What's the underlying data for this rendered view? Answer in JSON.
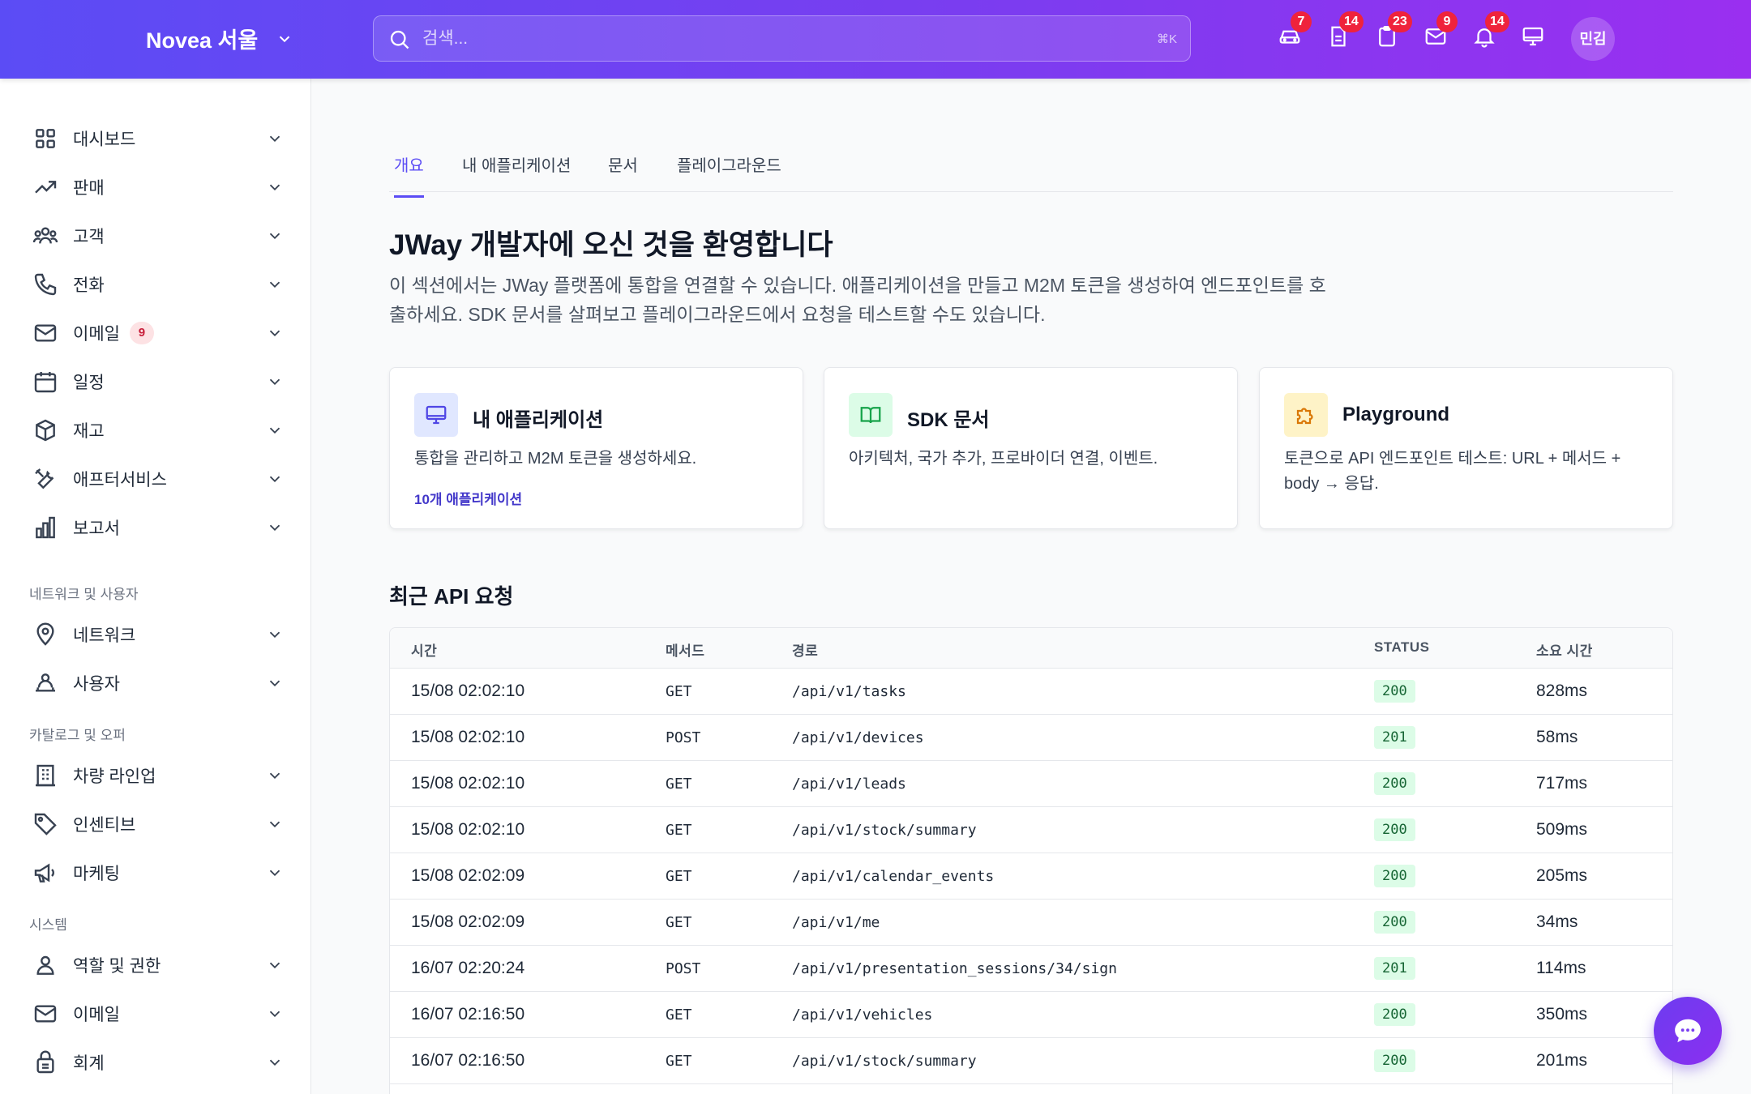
{
  "header": {
    "brand": "Novea 서울",
    "search_placeholder": "검색...",
    "search_shortcut": "⌘K",
    "icons": [
      {
        "name": "car-icon",
        "badge": "7"
      },
      {
        "name": "document-icon",
        "badge": "14"
      },
      {
        "name": "clipboard-icon",
        "badge": "23"
      },
      {
        "name": "mail-icon",
        "badge": "9"
      },
      {
        "name": "bell-icon",
        "badge": "14"
      },
      {
        "name": "monitor-icon",
        "badge": ""
      }
    ],
    "avatar_initials": "민김"
  },
  "sidebar": {
    "items": [
      {
        "label": "대시보드",
        "icon": "grid-icon"
      },
      {
        "label": "판매",
        "icon": "trending-up-icon"
      },
      {
        "label": "고객",
        "icon": "users-icon"
      },
      {
        "label": "전화",
        "icon": "phone-icon"
      },
      {
        "label": "이메일",
        "icon": "mail-icon",
        "badge": "9"
      },
      {
        "label": "일정",
        "icon": "calendar-icon"
      },
      {
        "label": "재고",
        "icon": "box-icon"
      },
      {
        "label": "애프터서비스",
        "icon": "tools-icon"
      },
      {
        "label": "보고서",
        "icon": "bar-chart-icon"
      }
    ],
    "section_network": "네트워크 및 사용자",
    "network_items": [
      {
        "label": "네트워크",
        "icon": "map-pin-icon"
      },
      {
        "label": "사용자",
        "icon": "user-network-icon"
      }
    ],
    "section_catalog": "카탈로그 및 오퍼",
    "catalog_items": [
      {
        "label": "차량 라인업",
        "icon": "building-icon"
      },
      {
        "label": "인센티브",
        "icon": "tag-icon"
      },
      {
        "label": "마케팅",
        "icon": "megaphone-icon"
      }
    ],
    "section_system": "시스템",
    "system_items": [
      {
        "label": "역할 및 권한",
        "icon": "user-icon"
      },
      {
        "label": "이메일",
        "icon": "mail-icon"
      },
      {
        "label": "회계",
        "icon": "lock-bag-icon"
      }
    ]
  },
  "tabs": [
    "개요",
    "내 애플리케이션",
    "문서",
    "플레이그라운드"
  ],
  "main": {
    "welcome": "JWay 개발자에 오신 것을 환영합니다",
    "intro": "이 섹션에서는 JWay 플랫폼에 통합을 연결할 수 있습니다. 애플리케이션을 만들고 M2M 토큰을 생성하여 엔드포인트를 호출하세요. SDK 문서를 살펴보고 플레이그라운드에서 요청을 테스트할 수도 있습니다.",
    "cards": [
      {
        "title": "내 애플리케이션",
        "desc": "통합을 관리하고 M2M 토큰을 생성하세요.",
        "link": "10개 애플리케이션",
        "icon": "monitor-icon"
      },
      {
        "title": "SDK 문서",
        "desc": "아키텍처, 국가 추가, 프로바이더 연결, 이벤트.",
        "link": "",
        "icon": "book-icon"
      },
      {
        "title": "Playground",
        "desc": "토큰으로 API 엔드포인트 테스트: URL + 메서드 + body → 응답.",
        "link": "",
        "icon": "puzzle-icon"
      }
    ],
    "recent_title": "최근 API 요청",
    "columns": [
      "시간",
      "메서드",
      "경로",
      "STATUS",
      "소요 시간"
    ],
    "rows": [
      [
        "15/08 02:02:10",
        "GET",
        "/api/v1/tasks",
        "200",
        "828ms"
      ],
      [
        "15/08 02:02:10",
        "POST",
        "/api/v1/devices",
        "201",
        "58ms"
      ],
      [
        "15/08 02:02:10",
        "GET",
        "/api/v1/leads",
        "200",
        "717ms"
      ],
      [
        "15/08 02:02:10",
        "GET",
        "/api/v1/stock/summary",
        "200",
        "509ms"
      ],
      [
        "15/08 02:02:09",
        "GET",
        "/api/v1/calendar_events",
        "200",
        "205ms"
      ],
      [
        "15/08 02:02:09",
        "GET",
        "/api/v1/me",
        "200",
        "34ms"
      ],
      [
        "16/07 02:20:24",
        "POST",
        "/api/v1/presentation_sessions/34/sign",
        "201",
        "114ms"
      ],
      [
        "16/07 02:16:50",
        "GET",
        "/api/v1/vehicles",
        "200",
        "350ms"
      ],
      [
        "16/07 02:16:50",
        "GET",
        "/api/v1/stock/summary",
        "200",
        "201ms"
      ]
    ]
  },
  "colors": {
    "accent": "#5b4cf5",
    "badge_red": "#ef233c",
    "status_green_bg": "#dcfce7",
    "status_green_fg": "#166534"
  }
}
